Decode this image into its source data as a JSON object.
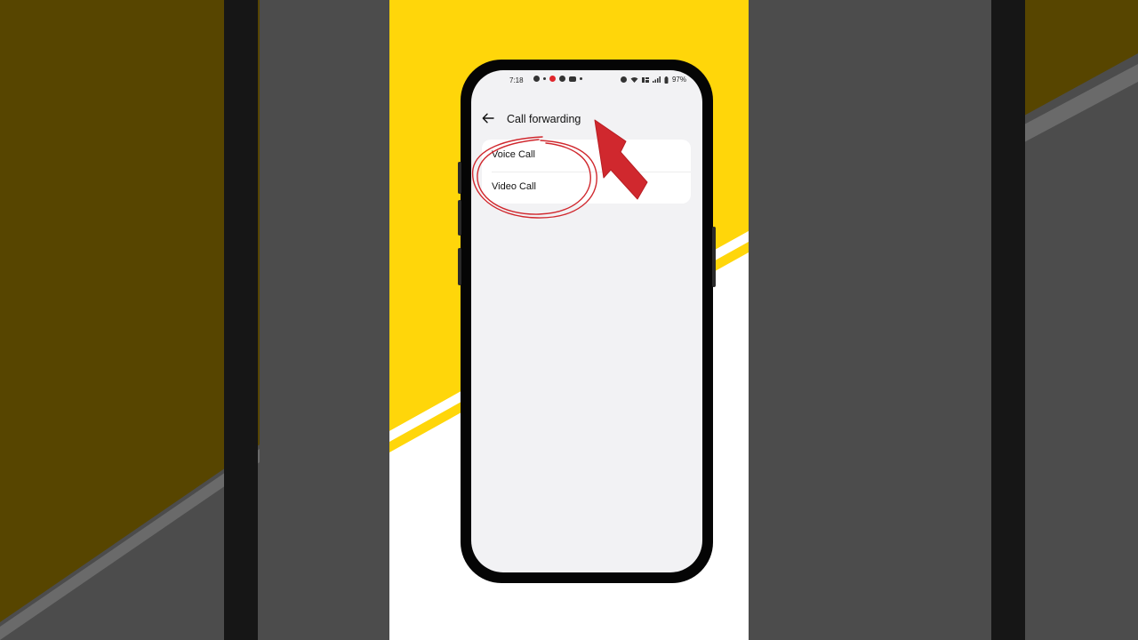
{
  "status_bar": {
    "time": "7:18",
    "battery": "97%",
    "left_icons": [
      "android-icon",
      "notification-icon",
      "jio-icon",
      "facebook-icon",
      "youtube-icon",
      "dot-icon"
    ],
    "right_icons": [
      "alarm-icon",
      "wifi-icon",
      "vo-lte-icon",
      "signal-icon",
      "battery-icon"
    ]
  },
  "app_bar": {
    "title": "Call forwarding",
    "back_icon": "back-arrow-icon"
  },
  "options": [
    {
      "label": "Voice Call"
    },
    {
      "label": "Video Call"
    }
  ],
  "colors": {
    "accent_yellow": "#FFD60A",
    "annotation_red": "#D0282E",
    "screen_bg": "#F2F2F4"
  }
}
